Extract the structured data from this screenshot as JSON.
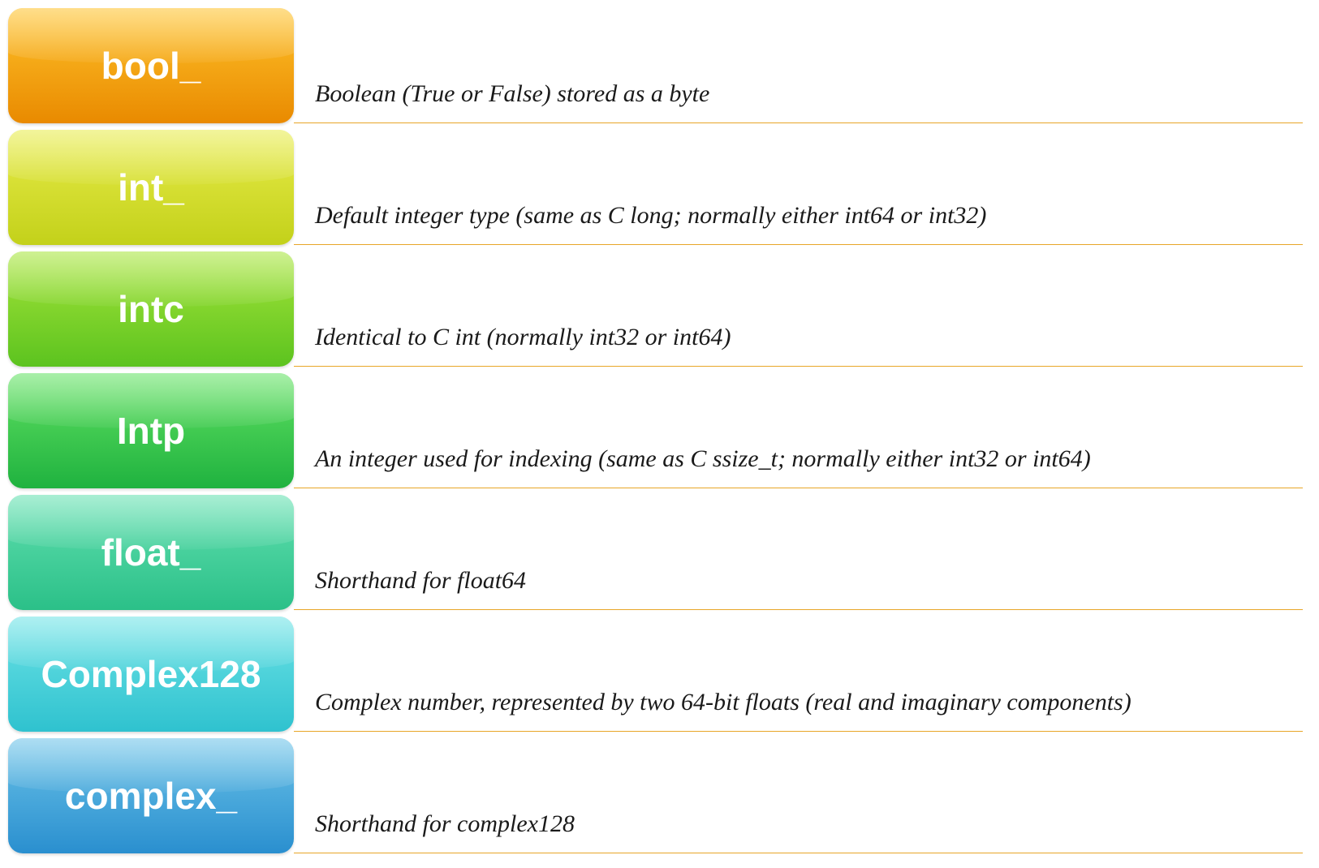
{
  "rows": [
    {
      "label": "bool_",
      "description": "Boolean (True or False) stored as a byte",
      "gradient_top": "#ffc32b",
      "gradient_bottom": "#e98a00"
    },
    {
      "label": "int_",
      "description": "Default integer type (same as C long; normally either int64 or int32)",
      "gradient_top": "#e8ec4a",
      "gradient_bottom": "#c3d11a"
    },
    {
      "label": "intc",
      "description": "Identical to C int (normally int32 or int64)",
      "gradient_top": "#a7e53a",
      "gradient_bottom": "#5cc31f"
    },
    {
      "label": "Intp",
      "description": "An integer used for indexing (same as C ssize_t; normally either int32 or int64)",
      "gradient_top": "#63e263",
      "gradient_bottom": "#1fb23f"
    },
    {
      "label": "float_",
      "description": "Shorthand for float64",
      "gradient_top": "#62e0b0",
      "gradient_bottom": "#2bc088"
    },
    {
      "label": "Complex128",
      "description": "Complex number, represented by two 64-bit floats (real and imaginary components)",
      "gradient_top": "#6de3e6",
      "gradient_bottom": "#2fc2cf"
    },
    {
      "label": "complex_",
      "description": "Shorthand for complex128",
      "gradient_top": "#6bc3e8",
      "gradient_bottom": "#2a8fcf"
    }
  ],
  "underline_color": "#e8a628"
}
